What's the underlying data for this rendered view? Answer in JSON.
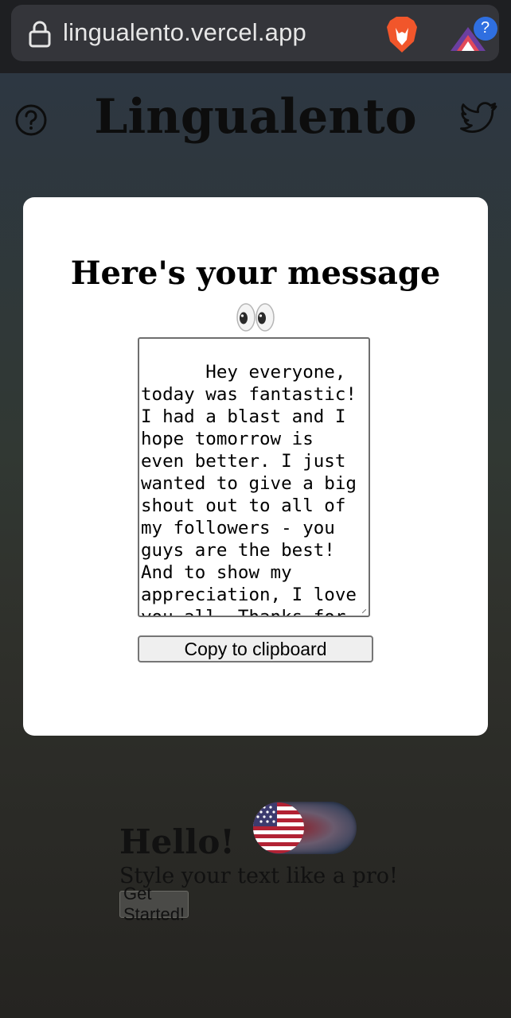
{
  "browser": {
    "url": "lingualento.vercel.app",
    "extension_badge": "?"
  },
  "header": {
    "title": "Lingualento"
  },
  "modal": {
    "title": "Here's your message",
    "emoji": "👀",
    "message": "Hey everyone, today was fantastic! I had a blast and I hope tomorrow is even better. I just wanted to give a big shout out to all of my followers - you guys are the best! And to show my appreciation, I love you all. Thanks for making my day and",
    "copy_label": "Copy to clipboard"
  },
  "hero": {
    "title": "Hello!",
    "subtitle": "Style your text like a pro!",
    "cta": "Get Started!"
  },
  "colors": {
    "modal_bg": "#ffffff",
    "page_bg_top": "#2d3742",
    "page_bg_bottom": "#252421"
  }
}
